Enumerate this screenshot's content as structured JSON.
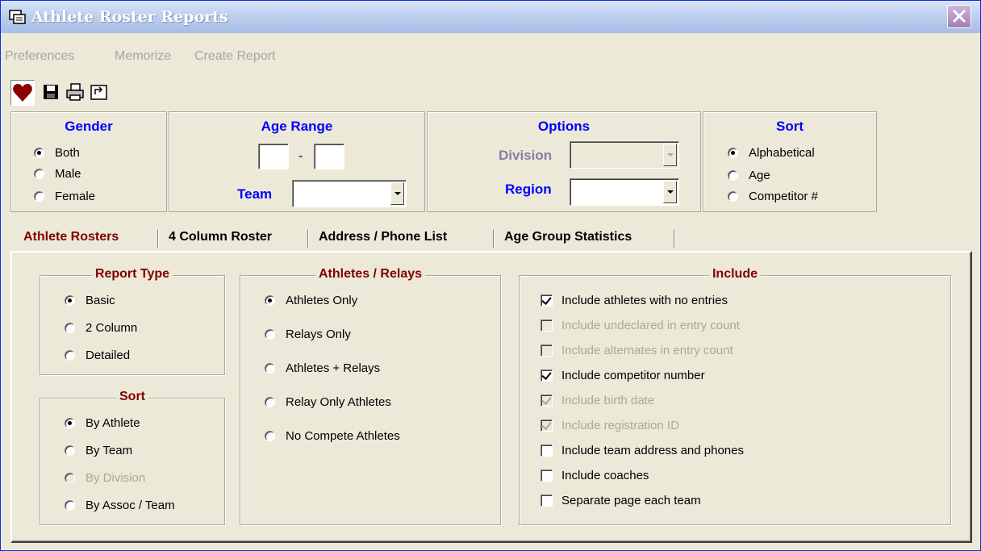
{
  "window": {
    "title": "Athlete Roster Reports"
  },
  "menu": [
    "Preferences",
    "Memorize",
    "Create Report"
  ],
  "toolbar": {
    "icons": [
      "heart-icon",
      "save-icon",
      "print-icon",
      "export-icon"
    ]
  },
  "gender": {
    "title": "Gender",
    "options": [
      "Both",
      "Male",
      "Female"
    ],
    "selected": "Both"
  },
  "age_range": {
    "title": "Age Range",
    "from": "",
    "to": "",
    "separator": "-",
    "team_label": "Team",
    "team_value": ""
  },
  "options": {
    "title": "Options",
    "division_label": "Division",
    "division_value": "",
    "region_label": "Region",
    "region_value": ""
  },
  "sort_top": {
    "title": "Sort",
    "options": [
      "Alphabetical",
      "Age",
      "Competitor #"
    ],
    "selected": "Alphabetical"
  },
  "tabs": [
    "Athlete Rosters",
    "4 Column Roster",
    "Address / Phone List",
    "Age Group Statistics"
  ],
  "active_tab": "Athlete Rosters",
  "report_type": {
    "title": "Report Type",
    "options": [
      "Basic",
      "2 Column",
      "Detailed"
    ],
    "selected": "Basic"
  },
  "sort_bottom": {
    "title": "Sort",
    "options": [
      "By Athlete",
      "By Team",
      "By Division",
      "By Assoc / Team"
    ],
    "selected": "By Athlete",
    "disabled": [
      "By Division"
    ]
  },
  "athletes_relays": {
    "title": "Athletes / Relays",
    "options": [
      "Athletes Only",
      "Relays Only",
      "Athletes + Relays",
      "Relay Only Athletes",
      "No Compete Athletes"
    ],
    "selected": "Athletes Only"
  },
  "include": {
    "title": "Include",
    "items": [
      {
        "label": "Include athletes with no entries",
        "checked": true,
        "enabled": true
      },
      {
        "label": "Include undeclared in entry count",
        "checked": false,
        "enabled": false
      },
      {
        "label": "Include alternates in entry count",
        "checked": false,
        "enabled": false
      },
      {
        "label": "Include competitor number",
        "checked": true,
        "enabled": true
      },
      {
        "label": "Include birth date",
        "checked": true,
        "enabled": false
      },
      {
        "label": "Include registration ID",
        "checked": true,
        "enabled": false
      },
      {
        "label": "Include team address and phones",
        "checked": false,
        "enabled": true
      },
      {
        "label": "Include coaches",
        "checked": false,
        "enabled": true
      },
      {
        "label": "Separate page each team",
        "checked": false,
        "enabled": true
      }
    ]
  }
}
